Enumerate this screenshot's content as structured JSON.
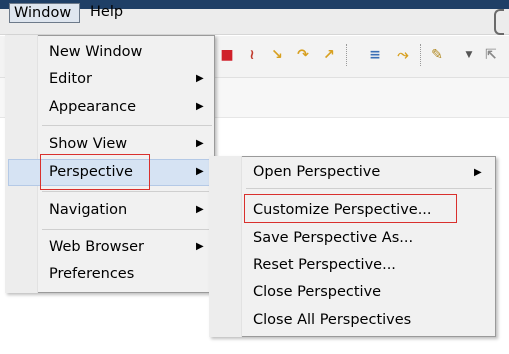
{
  "menubar": {
    "window": "Window",
    "help": "Help"
  },
  "window_menu": {
    "items": [
      {
        "label": "New Window",
        "has_submenu": false
      },
      {
        "label": "Editor",
        "has_submenu": true
      },
      {
        "label": "Appearance",
        "has_submenu": true
      },
      {
        "label": "Show View",
        "has_submenu": true
      },
      {
        "label": "Perspective",
        "has_submenu": true
      },
      {
        "label": "Navigation",
        "has_submenu": true
      },
      {
        "label": "Web Browser",
        "has_submenu": true
      },
      {
        "label": "Preferences",
        "has_submenu": false
      }
    ]
  },
  "perspective_submenu": {
    "items": [
      {
        "label": "Open Perspective",
        "has_submenu": true
      },
      {
        "label": "Customize Perspective...",
        "has_submenu": false
      },
      {
        "label": "Save Perspective As...",
        "has_submenu": false
      },
      {
        "label": "Reset Perspective...",
        "has_submenu": false
      },
      {
        "label": "Close Perspective",
        "has_submenu": false
      },
      {
        "label": "Close All Perspectives",
        "has_submenu": false
      }
    ]
  },
  "glyphs": {
    "arrow": "▶"
  },
  "colors": {
    "highlight": "#d6e3f3",
    "annotation_box": "#d9302d",
    "menubar_dark": "#1f3f66"
  },
  "icons": [
    "stop-icon",
    "connect-icon",
    "step-into-icon",
    "step-over-icon",
    "step-return-icon",
    "drop-to-frame-icon",
    "use-step-filters-icon",
    "edit-icon",
    "dropdown-icon",
    "pin-icon"
  ]
}
